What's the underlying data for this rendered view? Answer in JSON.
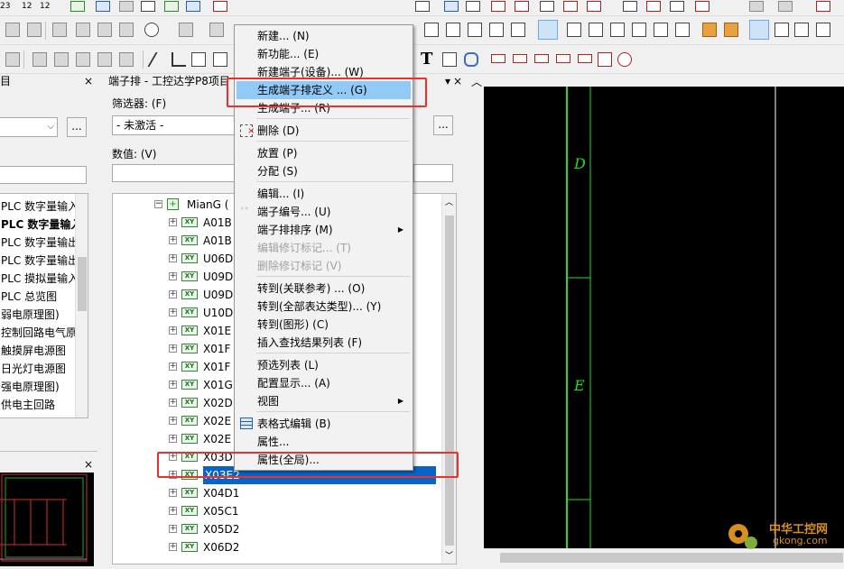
{
  "toolbar_top": {
    "row1_labels": [
      "23",
      "12",
      "12"
    ]
  },
  "left_panel": {
    "title": "目",
    "close": "×",
    "dropdown_button": "...",
    "items": [
      "PLC 数字量输入",
      "PLC 数字量输入",
      "PLC 数字量输出",
      "PLC 数字量输出",
      "PLC 摸拟量输入",
      "PLC 总览图",
      "弱电原理图)",
      "控制回路电气原",
      "触摸屏电源图",
      "日光灯电源图",
      "强电原理图)",
      "供电主回路"
    ]
  },
  "terminal_panel": {
    "title": "端子排 - 工控达学P8项目",
    "pin": "▾",
    "close": "×",
    "filter_label": "筛选器: (F)",
    "filter_value": "- 未激活 -",
    "filter_button": "...",
    "value_label": "数值: (V)",
    "value_button": "...",
    "tree_root": "MianG (",
    "tree_items": [
      "A01B",
      "A01B",
      "U06D",
      "U09D",
      "U09D",
      "U10D",
      "X01E",
      "X01F",
      "X01F",
      "X01G",
      "X02D",
      "X02E",
      "X02E",
      "X03D",
      "X03E2",
      "X04D1",
      "X05C1",
      "X05D2",
      "X06D2"
    ],
    "xy_tag": "XY"
  },
  "context_menu": {
    "items": [
      {
        "label": "新建... (N)",
        "disabled": false
      },
      {
        "label": "新功能... (E)",
        "disabled": false
      },
      {
        "label": "新建端子(设备)... (W)",
        "disabled": false
      },
      {
        "label": "生成端子排定义 ... (G)",
        "disabled": false,
        "highlighted": true
      },
      {
        "label": "生成端子... (R)",
        "disabled": false
      },
      {
        "label": "删除 (D)",
        "disabled": false
      },
      {
        "label": "放置 (P)",
        "disabled": false
      },
      {
        "label": "分配 (S)",
        "disabled": false
      },
      {
        "label": "编辑... (I)",
        "disabled": false
      },
      {
        "label": "端子编号... (U)",
        "disabled": false
      },
      {
        "label": "端子排排序 (M)",
        "disabled": false,
        "submenu": true
      },
      {
        "label": "编辑修订标记... (T)",
        "disabled": true
      },
      {
        "label": "删除修订标记 (V)",
        "disabled": true
      },
      {
        "label": "转到(关联参考) ... (O)",
        "disabled": false
      },
      {
        "label": "转到(全部表达类型)... (Y)",
        "disabled": false
      },
      {
        "label": "转到(图形) (C)",
        "disabled": false
      },
      {
        "label": "插入查找结果列表 (F)",
        "disabled": false
      },
      {
        "label": "预选列表 (L)",
        "disabled": false
      },
      {
        "label": "配置显示... (A)",
        "disabled": false
      },
      {
        "label": "视图",
        "disabled": false,
        "submenu": true
      },
      {
        "label": "表格式编辑 (B)",
        "disabled": false
      },
      {
        "label": "属性...",
        "disabled": false
      },
      {
        "label": "属性(全局)...",
        "disabled": false
      }
    ]
  },
  "drawing": {
    "label_d": "D",
    "label_e": "E",
    "watermark": "中华工控网",
    "watermark_url": "gkong.com",
    "line_color": "#22dd22",
    "bg_color": "#000000"
  }
}
